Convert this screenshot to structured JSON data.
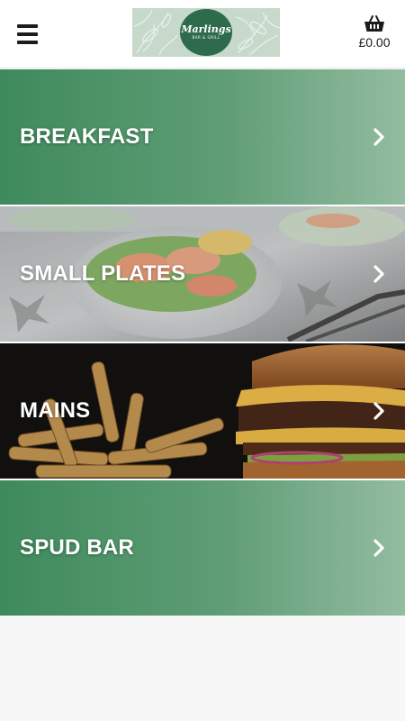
{
  "header": {
    "logo": {
      "name": "Marlings",
      "subtitle": "BAR & GRILL"
    },
    "basket": {
      "total": "£0.00"
    }
  },
  "categories": [
    {
      "label": "BREAKFAST"
    },
    {
      "label": "SMALL PLATES"
    },
    {
      "label": "MAINS"
    },
    {
      "label": "SPUD BAR"
    }
  ],
  "colors": {
    "brand_green": "#3e8a5c",
    "logo_bg": "#c7d9cb",
    "logo_circle": "#2e6a4c"
  }
}
